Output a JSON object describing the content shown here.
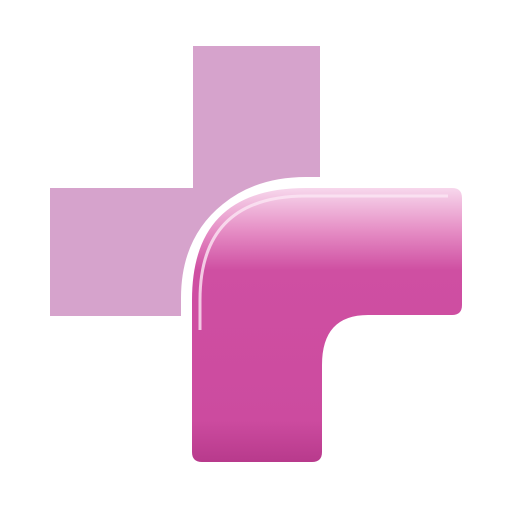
{
  "logo": {
    "icon_name": "medical-cross-logo-icon",
    "colors": {
      "light_pink": "#d6a3cc",
      "magenta": "#cf4fa2",
      "magenta_dark": "#b83a8c",
      "highlight": "#f4d4ea",
      "background": "#ffffff"
    }
  }
}
